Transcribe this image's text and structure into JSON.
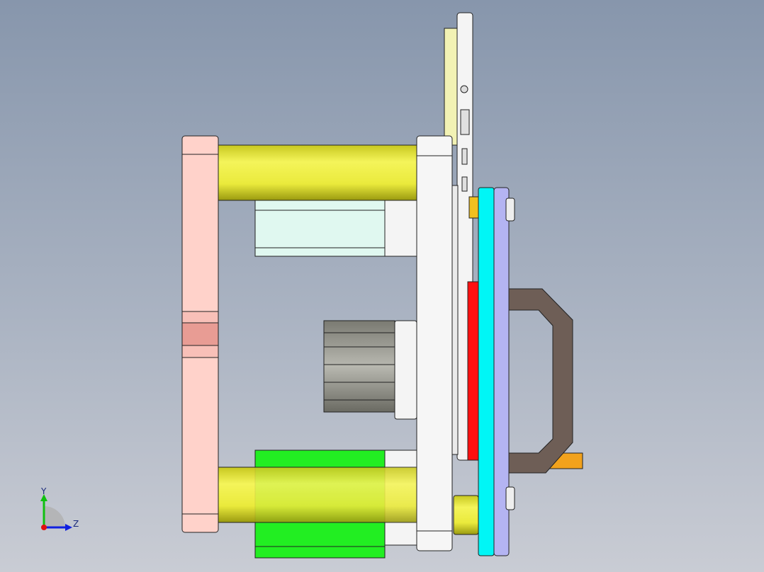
{
  "triad": {
    "y_label": "Y",
    "z_label": "Z"
  },
  "colors": {
    "background_top": "#8796ac",
    "background_bottom": "#c9ccd4",
    "pink_plate": "#ffd2ca",
    "yellow_rod": "#eaea3c",
    "cyan_plate": "#00f6f6",
    "purple_plate": "#b4b4f2",
    "red_part": "#ff1010",
    "green_block": "#22ee22",
    "handle": "#6e5e56",
    "orange_pin": "#f2a21c"
  }
}
